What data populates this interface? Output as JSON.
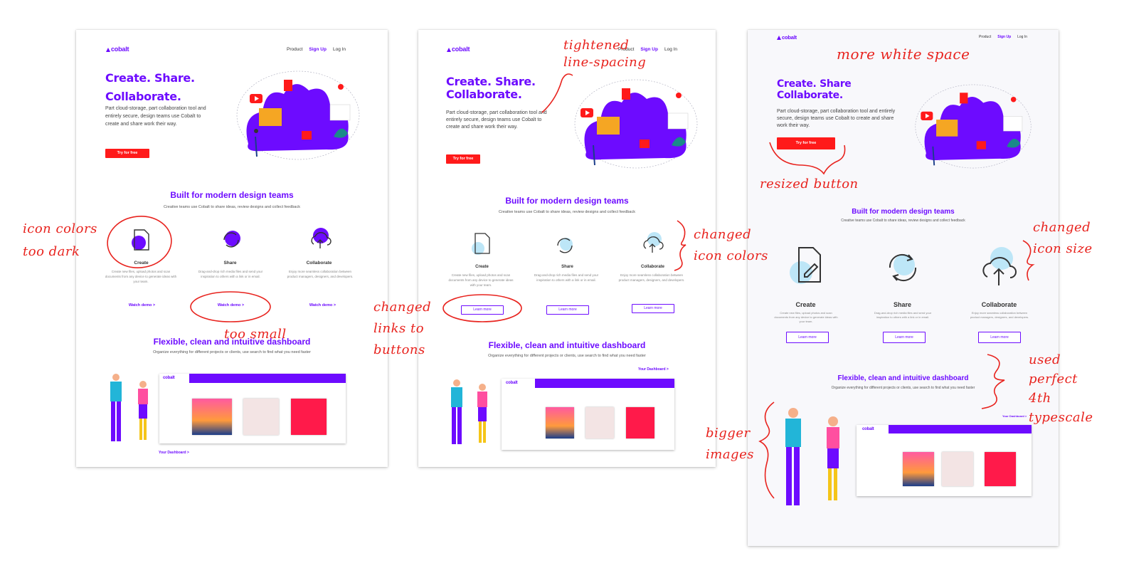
{
  "colors": {
    "brand": "#6d0bff",
    "cta": "#ff1a1a",
    "annotation": "#e8231e",
    "icon_light": "#bde6f7"
  },
  "brand": {
    "logo": "cobalt"
  },
  "nav": {
    "product": "Product",
    "signup": "Sign Up",
    "login": "Log In"
  },
  "hero": {
    "title_line1": "Create. Share.",
    "title_line2": "Collaborate.",
    "title_line1_v3": "Create. Share",
    "body_v1": "Part cloud-storage, part collaboration tool and entirely secure, design teams use Cobalt to create and share work their way.",
    "body_v2": "Part cloud-storage, part collaboration tool and entirely secure, design teams use Cobalt to create and share work their way.",
    "body_v3": "Part cloud-storage, part collaboration tool and entirely secure, design teams use Cobalt to create and share work their way.",
    "cta": "Try for free"
  },
  "features": {
    "title": "Built for modern design teams",
    "subtitle": "Creative teams use Cobalt to share ideas, review designs and collect feedback",
    "items": [
      {
        "name": "Create",
        "icon": "document-pen-icon",
        "desc": "Create new files, upload photos and scan documents from any device to generate ideas with your team."
      },
      {
        "name": "Share",
        "icon": "refresh-arrows-icon",
        "desc": "Drag-and-drop rich media files and send your inspiration to others with a link or in email."
      },
      {
        "name": "Collaborate",
        "icon": "cloud-upload-icon",
        "desc": "Enjoy more seamless collaboration between product managers, designers, and developers."
      }
    ],
    "watch_demo": "Watch demo >",
    "learn_more": "Learn more"
  },
  "dashboard": {
    "title": "Flexible, clean and intuitive dashboard",
    "subtitle": "Organize everything for different projects or clients, use search to find what you need faster",
    "link": "Your Dashboard >"
  },
  "annotations": {
    "tightened": [
      "tightened",
      "line-spacing"
    ],
    "icon_colors": [
      "icon colors",
      "too dark"
    ],
    "too_small": "too small",
    "changed_links": [
      "changed",
      "links to",
      "buttons"
    ],
    "changed_icon_colors": [
      "changed",
      "icon colors"
    ],
    "more_white_space": "more white space",
    "resized_button": "resized button",
    "changed_icon_size": [
      "changed",
      "icon size"
    ],
    "perfect_4th": [
      "used",
      "perfect",
      "4th",
      "typescale"
    ],
    "bigger_images": [
      "bigger",
      "images"
    ]
  }
}
